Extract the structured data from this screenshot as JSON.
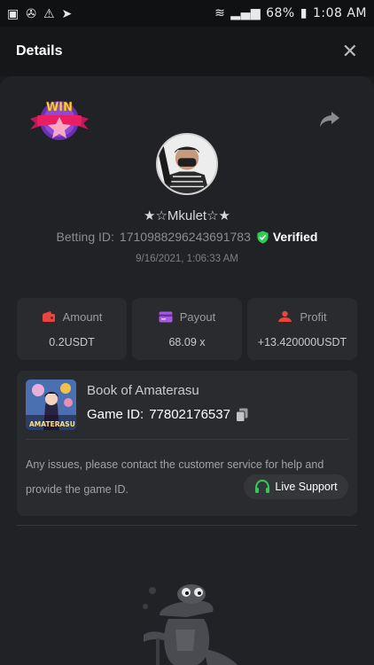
{
  "status_bar": {
    "battery": "68%",
    "time": "1:08 AM"
  },
  "header": {
    "title": "Details",
    "close_icon": "close-icon"
  },
  "bet": {
    "badge": "WIN",
    "username": "★☆Mkulet☆★",
    "betting_id_label": "Betting ID:",
    "betting_id": "1710988296243691783",
    "verified": "Verified",
    "timestamp": "9/16/2021, 1:06:33 AM"
  },
  "stats": [
    {
      "label": "Amount",
      "value": "0.2USDT",
      "icon": "wallet-icon",
      "color": "#e8453c"
    },
    {
      "label": "Payout",
      "value": "68.09 x",
      "icon": "card-icon",
      "color": "#a55be0"
    },
    {
      "label": "Profit",
      "value": "+13.420000USDT",
      "icon": "profit-icon",
      "color": "#e8453c"
    }
  ],
  "game": {
    "name": "Book of Amaterasu",
    "id_label": "Game ID:",
    "id": "77802176537",
    "thumb_text": "AMATERASU",
    "support_line1": "Any issues, please contact the customer service for help and",
    "support_line2": "provide the game ID.",
    "live_support": "Live Support"
  },
  "colors": {
    "background": "#1a1b1d",
    "panel": "#212225",
    "card": "#2a2b2f",
    "verified": "#2ecc52"
  }
}
